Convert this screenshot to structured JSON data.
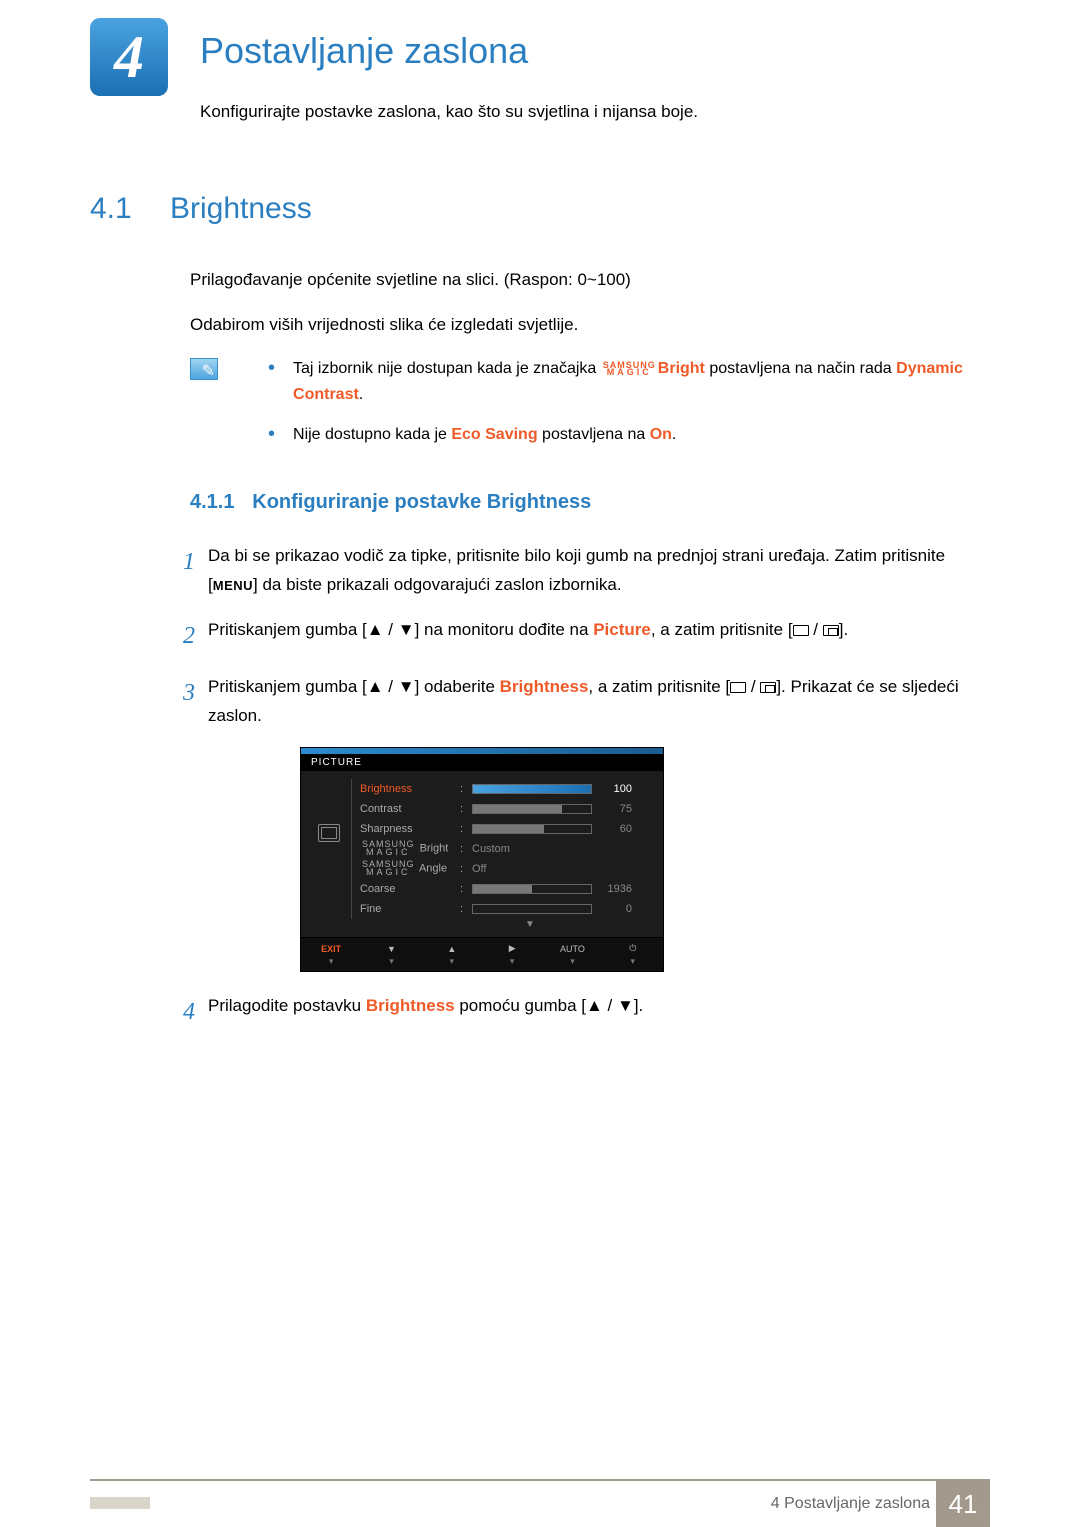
{
  "chapter": {
    "number": "4",
    "title": "Postavljanje zaslona",
    "subtitle": "Konfigurirajte postavke zaslona, kao što su svjetlina i nijansa boje."
  },
  "section": {
    "number": "4.1",
    "title": "Brightness",
    "intro1": "Prilagođavanje općenite svjetline na slici. (Raspon: 0~100)",
    "intro2": "Odabirom viših vrijednosti slika će izgledati svjetlije."
  },
  "notes": {
    "n1_a": "Taj izbornik nije dostupan kada je značajka ",
    "n1_bright": "Bright",
    "n1_b": " postavljena na način rada ",
    "n1_hl": "Dynamic Contrast",
    "n1_c": ".",
    "n2_a": "Nije dostupno kada je ",
    "n2_hl1": "Eco Saving",
    "n2_b": " postavljena na ",
    "n2_hl2": "On",
    "n2_c": "."
  },
  "samsung_magic": {
    "top": "SAMSUNG",
    "bot": "MAGIC"
  },
  "subsection": {
    "number": "4.1.1",
    "title": "Konfiguriranje postavke Brightness"
  },
  "steps": {
    "s1_num": "1",
    "s1_a": "Da bi se prikazao vodič za tipke, pritisnite bilo koji gumb na prednjoj strani uređaja. Zatim pritisnite [",
    "s1_menu": "MENU",
    "s1_b": "] da biste prikazali odgovarajući zaslon izbornika.",
    "s2_num": "2",
    "s2_a": "Pritiskanjem gumba [",
    "s2_b": "] na monitoru dođite na ",
    "s2_hl": "Picture",
    "s2_c": ", a zatim pritisnite [",
    "s2_d": "].",
    "s3_num": "3",
    "s3_a": "Pritiskanjem gumba [",
    "s3_b": "] odaberite ",
    "s3_hl": "Brightness",
    "s3_c": ", a zatim pritisnite [",
    "s3_d": "]. Prikazat će se sljedeći zaslon.",
    "s4_num": "4",
    "s4_a": "Prilagodite postavku ",
    "s4_hl": "Brightness",
    "s4_b": " pomoću gumba [",
    "s4_c": "]."
  },
  "osd": {
    "title": "PICTURE",
    "rows": [
      {
        "label": "Brightness",
        "value": "100",
        "fill": 100,
        "selected": true,
        "bar": true
      },
      {
        "label": "Contrast",
        "value": "75",
        "fill": 75,
        "selected": false,
        "bar": true
      },
      {
        "label": "Sharpness",
        "value": "60",
        "fill": 60,
        "selected": false,
        "bar": true
      },
      {
        "label": "SAMSUNG_MAGIC_Bright",
        "text": "Custom",
        "bar": false
      },
      {
        "label": "SAMSUNG_MAGIC_Angle",
        "text": "Off",
        "bar": false
      },
      {
        "label": "Coarse",
        "value": "1936",
        "fill": 50,
        "selected": false,
        "bar": true
      },
      {
        "label": "Fine",
        "value": "0",
        "fill": 0,
        "selected": false,
        "bar": true
      }
    ],
    "footer": [
      "EXIT",
      "▼",
      "▲",
      "▶",
      "AUTO",
      "⏻"
    ],
    "footer_bot": "▾"
  },
  "footer": {
    "text": "4 Postavljanje zaslona",
    "page": "41"
  }
}
